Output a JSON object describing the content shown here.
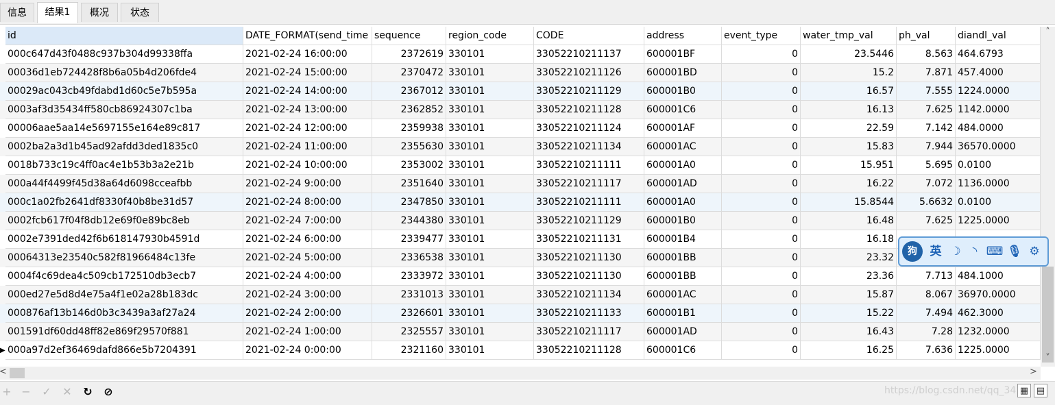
{
  "tabs": [
    "信息",
    "结果1",
    "概况",
    "状态"
  ],
  "active_tab": 1,
  "columns": [
    "id",
    "DATE_FORMAT(send_time",
    "sequence",
    "region_code",
    "CODE",
    "address",
    "event_type",
    "water_tmp_val",
    "ph_val",
    "diandl_val"
  ],
  "rows": [
    [
      "000c647d43f0488c937b304d99338ffa",
      "2021-02-24 16:00:00",
      "2372619",
      "330101",
      "33052210211137",
      "600001BF",
      "0",
      "23.5446",
      "8.563",
      "464.6793"
    ],
    [
      "00036d1eb724428f8b6a05b4d206fde4",
      "2021-02-24 15:00:00",
      "2370472",
      "330101",
      "33052210211126",
      "600001BD",
      "0",
      "15.2",
      "7.871",
      "457.4000"
    ],
    [
      "00029ac043cb49fdabd1d60c5e7b595a",
      "2021-02-24 14:00:00",
      "2367012",
      "330101",
      "33052210211129",
      "600001B0",
      "0",
      "16.57",
      "7.555",
      "1224.0000"
    ],
    [
      "0003af3d35434ff580cb86924307c1ba",
      "2021-02-24 13:00:00",
      "2362852",
      "330101",
      "33052210211128",
      "600001C6",
      "0",
      "16.13",
      "7.625",
      "1142.0000"
    ],
    [
      "00006aae5aa14e5697155e164e89c817",
      "2021-02-24 12:00:00",
      "2359938",
      "330101",
      "33052210211124",
      "600001AF",
      "0",
      "22.59",
      "7.142",
      "484.0000"
    ],
    [
      "0002ba2a3d1b45ad92afdd3ded1835c0",
      "2021-02-24 11:00:00",
      "2355630",
      "330101",
      "33052210211134",
      "600001AC",
      "0",
      "15.83",
      "7.944",
      "36570.0000"
    ],
    [
      "0018b733c19c4ff0ac4e1b53b3a2e21b",
      "2021-02-24 10:00:00",
      "2353002",
      "330101",
      "33052210211111",
      "600001A0",
      "0",
      "15.951",
      "5.695",
      "0.0100"
    ],
    [
      "000a44f4499f45d38a64d6098cceafbb",
      "2021-02-24 9:00:00",
      "2351640",
      "330101",
      "33052210211117",
      "600001AD",
      "0",
      "16.22",
      "7.072",
      "1136.0000"
    ],
    [
      "000c1a02fb2641df8330f40b8be31d57",
      "2021-02-24 8:00:00",
      "2347850",
      "330101",
      "33052210211111",
      "600001A0",
      "0",
      "15.8544",
      "5.6632",
      "0.0100"
    ],
    [
      "0002fcb617f04f8db12e69f0e89bc8eb",
      "2021-02-24 7:00:00",
      "2344380",
      "330101",
      "33052210211129",
      "600001B0",
      "0",
      "16.48",
      "7.625",
      "1225.0000"
    ],
    [
      "0002e7391ded42f6b618147930b4591d",
      "2021-02-24 6:00:00",
      "2339477",
      "330101",
      "33052210211131",
      "600001B4",
      "0",
      "16.18",
      "",
      ""
    ],
    [
      "00064313e23540c582f81966484c13fe",
      "2021-02-24 5:00:00",
      "2336538",
      "330101",
      "33052210211130",
      "600001BB",
      "0",
      "23.32",
      "",
      ""
    ],
    [
      "0004f4c69dea4c509cb172510db3ecb7",
      "2021-02-24 4:00:00",
      "2333972",
      "330101",
      "33052210211130",
      "600001BB",
      "0",
      "23.36",
      "7.713",
      "484.1000"
    ],
    [
      "000ed27e5d8d4e75a4f1e02a28b183dc",
      "2021-02-24 3:00:00",
      "2331013",
      "330101",
      "33052210211134",
      "600001AC",
      "0",
      "15.87",
      "8.067",
      "36970.0000"
    ],
    [
      "000876af13b146d0b3c3439a3af27a24",
      "2021-02-24 2:00:00",
      "2326601",
      "330101",
      "33052210211133",
      "600001B1",
      "0",
      "15.22",
      "7.494",
      "462.3000"
    ],
    [
      "001591df60dd48ff82e869f29570f881",
      "2021-02-24 1:00:00",
      "2325557",
      "330101",
      "33052210211117",
      "600001AD",
      "0",
      "16.43",
      "7.28",
      "1232.0000"
    ],
    [
      "000a97d2ef36469dafd866e5b7204391",
      "2021-02-24 0:00:00",
      "2321160",
      "330101",
      "33052210211128",
      "600001C6",
      "0",
      "16.25",
      "7.636",
      "1225.0000"
    ]
  ],
  "current_row": 16,
  "toolbar": {
    "add": "+",
    "remove": "−",
    "apply": "✓",
    "discard": "✕",
    "refresh": "↻",
    "stop": "⊘"
  },
  "watermark": "https://blog.csdn.net/qq_34",
  "ime_bar": {
    "logo": "狗",
    "lang": "英",
    "moon": "☽",
    "comma": "◝",
    "keyboard": "⌨",
    "mic": "🎙",
    "settings": "⚙"
  },
  "scroll": {
    "up": "˄",
    "down": "˅",
    "left": "<",
    "right": ">"
  },
  "view_buttons": [
    "▦",
    "▤"
  ],
  "colors": {
    "header_selected": "#dbe9f8",
    "row_alt": "#f5f5f5",
    "row_highlight": "#eef5fb",
    "grid_line": "#dcdcdc",
    "ime_border": "#5e9bd6"
  }
}
